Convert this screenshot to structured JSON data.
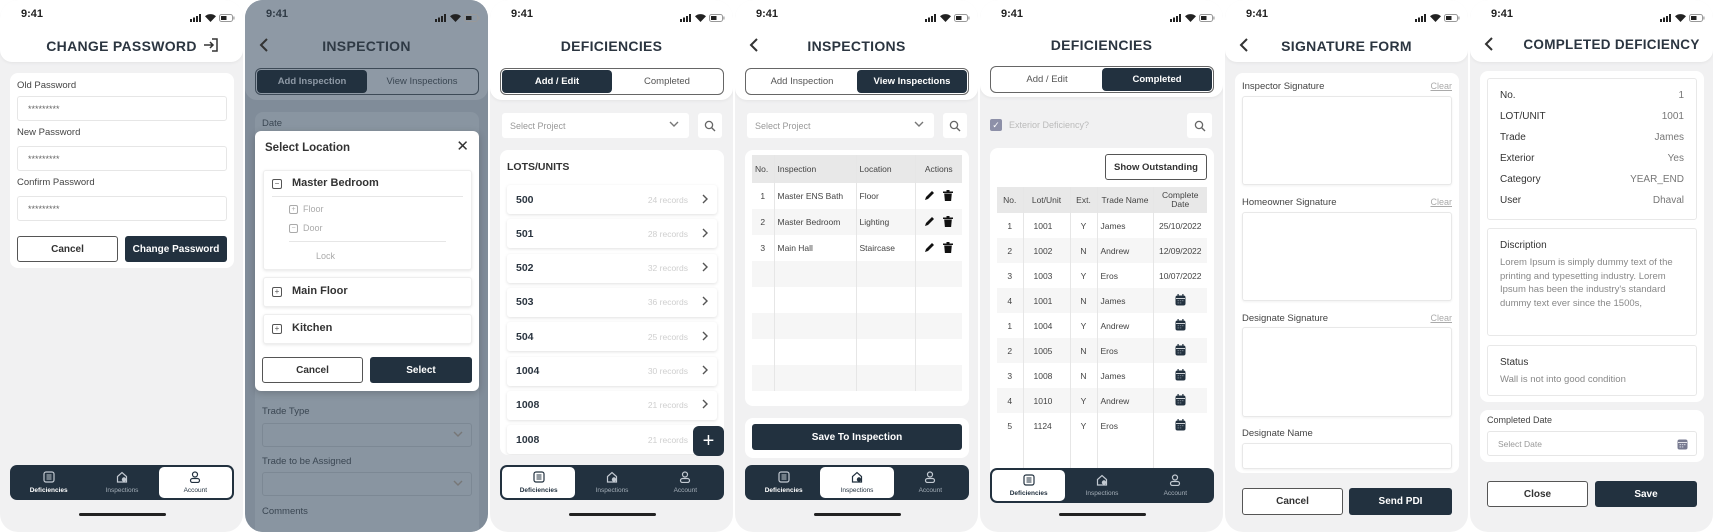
{
  "status": {
    "time": "9:41"
  },
  "colors": {
    "primary": "#22313f",
    "background": "#f1f1f2",
    "overlay": "#8b96a2"
  },
  "tabbar": {
    "items": [
      {
        "label": "Deficiencies",
        "icon": "list-icon"
      },
      {
        "label": "Inspections",
        "icon": "home-icon"
      },
      {
        "label": "Account",
        "icon": "user-icon"
      }
    ]
  },
  "change_password": {
    "title": "CHANGE PASSWORD",
    "fields": [
      {
        "label": "Old Password",
        "value": "*********"
      },
      {
        "label": "New Password",
        "value": "*********"
      },
      {
        "label": "Confirm Password",
        "value": "*********"
      }
    ],
    "cancel": "Cancel",
    "submit": "Change Password",
    "active_tab": 2
  },
  "inspection_add": {
    "title": "INSPECTION",
    "tabs": [
      "Add Inspection",
      "View Inspections"
    ],
    "active_segment": 0,
    "date_label": "Date",
    "trade_type_label": "Trade Type",
    "trade_assigned_label": "Trade to be Assigned",
    "comments_label": "Comments",
    "modal": {
      "title": "Select Location",
      "groups": [
        {
          "name": "Master Bedroom",
          "expanded": true,
          "children": [
            {
              "name": "Floor",
              "expanded": false
            },
            {
              "name": "Door",
              "expanded": true
            }
          ],
          "leaf": "Lock"
        },
        {
          "name": "Main Floor",
          "expanded": false
        },
        {
          "name": "Kitchen",
          "expanded": false
        }
      ],
      "cancel": "Cancel",
      "select": "Select"
    }
  },
  "deficiencies": {
    "title": "DEFICIENCIES",
    "tabs": [
      "Add / Edit",
      "Completed"
    ],
    "active_segment": 0,
    "project_placeholder": "Select Project",
    "section_title": "LOTS/UNITS",
    "lots": [
      {
        "unit": "500",
        "records": "24 records"
      },
      {
        "unit": "501",
        "records": "28 records"
      },
      {
        "unit": "502",
        "records": "32 records"
      },
      {
        "unit": "503",
        "records": "36 records"
      },
      {
        "unit": "504",
        "records": "25 records"
      },
      {
        "unit": "1004",
        "records": "30 records"
      },
      {
        "unit": "1008",
        "records": "21 records"
      },
      {
        "unit": "1008",
        "records": "21 records"
      }
    ],
    "fab": "+",
    "active_tab": 0
  },
  "inspections_view": {
    "title": "INSPECTIONS",
    "tabs": [
      "Add Inspection",
      "View Inspections"
    ],
    "active_segment": 1,
    "project_placeholder": "Select Project",
    "columns": [
      "No.",
      "Inspection",
      "Location",
      "Actions"
    ],
    "rows": [
      {
        "no": "1",
        "inspection": "Master ENS Bath",
        "location": "Floor"
      },
      {
        "no": "2",
        "inspection": "Master Bedroom",
        "location": "Lighting"
      },
      {
        "no": "3",
        "inspection": "Main Hall",
        "location": "Staircase"
      }
    ],
    "save": "Save To Inspection",
    "active_tab": 1
  },
  "deficiencies_completed": {
    "title": "DEFICIENCIES",
    "tabs": [
      "Add / Edit",
      "Completed"
    ],
    "active_segment": 1,
    "exterior_label": "Exterior Deficiency?",
    "exterior_checked": true,
    "show_outstanding": "Show Outstanding",
    "columns": [
      "No.",
      "Lot/Unit",
      "Ext.",
      "Trade Name",
      "Complete Date"
    ],
    "rows": [
      {
        "no": "1",
        "lot": "1001",
        "ext": "Y",
        "trade": "James",
        "date": "25/10/2022"
      },
      {
        "no": "2",
        "lot": "1002",
        "ext": "N",
        "trade": "Andrew",
        "date": "12/09/2022"
      },
      {
        "no": "3",
        "lot": "1003",
        "ext": "Y",
        "trade": "Eros",
        "date": "10/07/2022"
      },
      {
        "no": "4",
        "lot": "1001",
        "ext": "N",
        "trade": "James",
        "date": null
      },
      {
        "no": "1",
        "lot": "1004",
        "ext": "Y",
        "trade": "Andrew",
        "date": null
      },
      {
        "no": "2",
        "lot": "1005",
        "ext": "N",
        "trade": "Eros",
        "date": null
      },
      {
        "no": "3",
        "lot": "1008",
        "ext": "N",
        "trade": "James",
        "date": null
      },
      {
        "no": "4",
        "lot": "1010",
        "ext": "Y",
        "trade": "Andrew",
        "date": null
      },
      {
        "no": "5",
        "lot": "1124",
        "ext": "Y",
        "trade": "Eros",
        "date": null
      }
    ],
    "active_tab": 0
  },
  "signature_form": {
    "title": "SIGNATURE FORM",
    "sections": [
      {
        "label": "Inspector Signature",
        "clear": "Clear"
      },
      {
        "label": "Homeowner Signature",
        "clear": "Clear"
      },
      {
        "label": "Designate Signature",
        "clear": "Clear"
      }
    ],
    "designate_name_label": "Designate Name",
    "cancel": "Cancel",
    "send": "Send PDI"
  },
  "completed_deficiency": {
    "title": "COMPLETED DEFICIENCY",
    "details": [
      {
        "label": "No.",
        "value": "1"
      },
      {
        "label": "LOT/UNIT",
        "value": "1001"
      },
      {
        "label": "Trade",
        "value": "James"
      },
      {
        "label": "Exterior",
        "value": "Yes"
      },
      {
        "label": "Category",
        "value": "YEAR_END"
      },
      {
        "label": "User",
        "value": "Dhaval"
      }
    ],
    "description_label": "Discription",
    "description": "Lorem Ipsum is simply dummy text of the printing and typesetting industry. Lorem Ipsum has been the industry's standard dummy text ever since the 1500s,",
    "status_label": "Status",
    "status": "Wall is not into good condition",
    "completed_date_label": "Completed Date",
    "date_placeholder": "Select Date",
    "close": "Close",
    "save": "Save"
  }
}
